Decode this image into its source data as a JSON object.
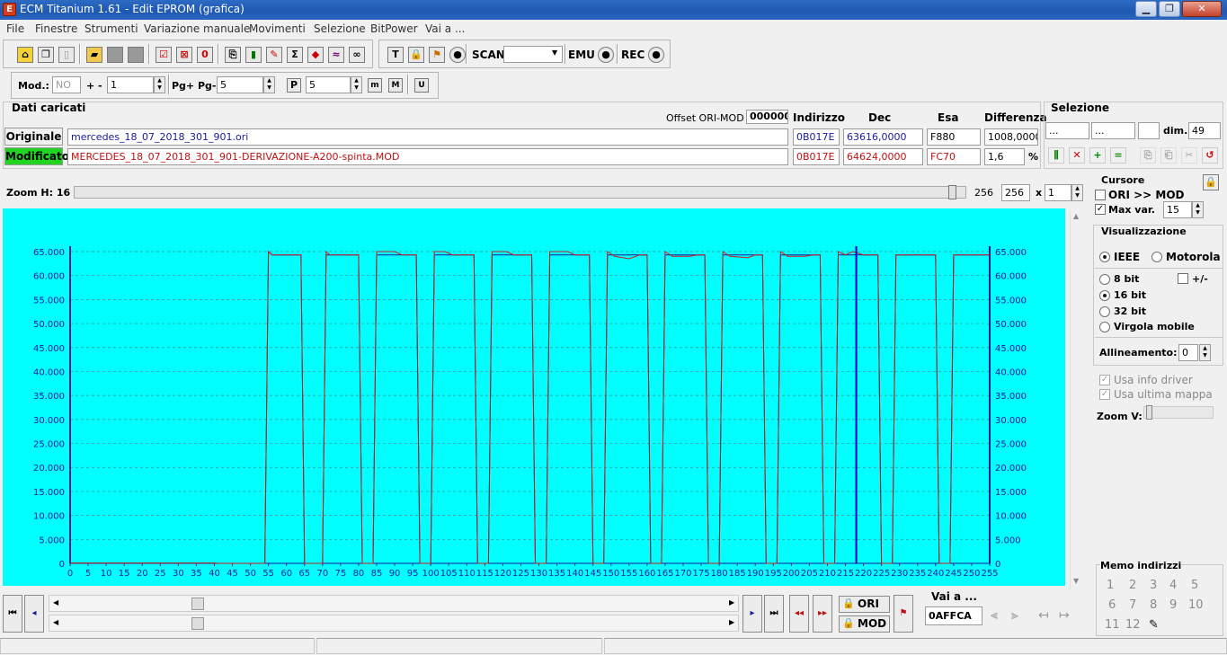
{
  "window": {
    "title": "ECM Titanium 1.61 - Edit EPROM (grafica)",
    "app_icon": "E"
  },
  "menu": [
    "File",
    "Finestre",
    "Strumenti",
    "Variazione manuale",
    "Movimenti",
    "Selezione",
    "BitPower",
    "Vai a ..."
  ],
  "toolbar1": {
    "scan_label": "SCAN",
    "emu_label": "EMU",
    "rec_label": "REC",
    "scan_value": ""
  },
  "toolbar2": {
    "mod_label": "Mod.:",
    "mod_value": "NO",
    "plus_minus_label": "+ -",
    "plus_minus_value": "1",
    "pg_label": "Pg+ Pg-",
    "pg_value": "5",
    "p_value": "5"
  },
  "dati": {
    "section_title": "Dati caricati",
    "offset_label": "Offset ORI-MOD",
    "offset_value": "000000",
    "col_indirizzo": "Indirizzo",
    "col_dec": "Dec",
    "col_esa": "Esa",
    "col_differenza": "Differenza",
    "originale_label": "Originale",
    "originale_file": "mercedes_18_07_2018_301_901.ori",
    "originale_addr": "0B017E",
    "originale_dec": "63616,0000",
    "originale_esa": "F880",
    "originale_diff": "1008,0000",
    "modificato_label": "Modificato",
    "modificato_file": "MERCEDES_18_07_2018_301_901-DERIVAZIONE-A200-spinta.MOD",
    "modificato_addr": "0B017E",
    "modificato_dec": "64624,0000",
    "modificato_esa": "FC70",
    "modificato_diff": "1,6",
    "percent": "%"
  },
  "selezione": {
    "title": "Selezione",
    "field1": "...",
    "field2": "...",
    "field3": "",
    "dim_label": "dim.",
    "dim_value": "49"
  },
  "zoom": {
    "label": "Zoom H: 16",
    "value_a": "256",
    "value_b": "256",
    "times": "x",
    "value_c": "1",
    "level": 0.99
  },
  "cursore": {
    "title": "Cursore",
    "ori_mod_label": "ORI >> MOD",
    "ori_mod_checked": false,
    "max_var_label": "Max var.",
    "max_var_checked": true,
    "max_var_value": "15"
  },
  "visualizzazione": {
    "title": "Visualizzazione",
    "ieee": "IEEE",
    "motorola": "Motorola",
    "endianness": "IEEE",
    "bit8": "8 bit",
    "bit16": "16 bit",
    "bit32": "32 bit",
    "float": "Virgola mobile",
    "selected_bits": "16 bit",
    "plusminus": "+/-",
    "allineamento_label": "Allineamento:",
    "allineamento_value": "0",
    "usa_info_driver": "Usa info driver",
    "usa_ultima_mappa": "Usa ultima mappa",
    "zoom_v_label": "Zoom V:"
  },
  "memo": {
    "title": "Memo indirizzi",
    "items": [
      "1",
      "2",
      "3",
      "4",
      "5",
      "6",
      "7",
      "8",
      "9",
      "10",
      "11",
      "12"
    ]
  },
  "bottom": {
    "ori_label": "ORI",
    "mod_label": "MOD",
    "vai_a_label": "Vai a ...",
    "vai_a_value": "0AFFCA",
    "scroll_pos": 0.2
  },
  "colors": {
    "chart_bg": "#00ffff",
    "ori_line": "#1a1aa0",
    "mod_line": "#d01a1a",
    "cursor": "#0000cc",
    "modificato_bg": "#21d421",
    "grid": "#4a8a8a"
  },
  "chart_data": {
    "type": "line",
    "xlim": [
      0,
      255
    ],
    "ylim": [
      0,
      65000
    ],
    "x_ticks": [
      0,
      5,
      10,
      15,
      20,
      25,
      30,
      35,
      40,
      45,
      50,
      55,
      60,
      65,
      70,
      75,
      80,
      85,
      90,
      95,
      100,
      105,
      110,
      115,
      120,
      125,
      130,
      135,
      140,
      145,
      150,
      155,
      160,
      165,
      170,
      175,
      180,
      185,
      190,
      195,
      200,
      205,
      210,
      215,
      220,
      225,
      230,
      235,
      240,
      245,
      250,
      255
    ],
    "y_ticks": [
      "0",
      "5.000",
      "10.000",
      "15.000",
      "20.000",
      "25.000",
      "30.000",
      "35.000",
      "40.000",
      "45.000",
      "50.000",
      "55.000",
      "60.000",
      "65.000"
    ],
    "y_tick_values": [
      0,
      5000,
      10000,
      15000,
      20000,
      25000,
      30000,
      35000,
      40000,
      45000,
      50000,
      55000,
      60000,
      65000
    ],
    "cursor_x": 218,
    "series": [
      {
        "color": "#1a1aa0",
        "points": [
          [
            0,
            30
          ],
          [
            40,
            30
          ],
          [
            41,
            0
          ],
          [
            54,
            0
          ],
          [
            55,
            65000
          ],
          [
            56,
            64300
          ],
          [
            64,
            64300
          ],
          [
            65,
            0
          ],
          [
            70,
            0
          ],
          [
            71,
            64300
          ],
          [
            80,
            64300
          ],
          [
            81,
            0
          ],
          [
            84,
            0
          ],
          [
            85,
            64300
          ],
          [
            96,
            64300
          ],
          [
            97,
            0
          ],
          [
            100,
            0
          ],
          [
            101,
            64300
          ],
          [
            112,
            64300
          ],
          [
            113,
            0
          ],
          [
            116,
            0
          ],
          [
            117,
            64300
          ],
          [
            128,
            64300
          ],
          [
            129,
            0
          ],
          [
            132,
            0
          ],
          [
            133,
            64300
          ],
          [
            144,
            64300
          ],
          [
            145,
            0
          ],
          [
            148,
            0
          ],
          [
            149,
            64300
          ],
          [
            160,
            64300
          ],
          [
            161,
            0
          ],
          [
            164,
            0
          ],
          [
            165,
            64300
          ],
          [
            176,
            64300
          ],
          [
            177,
            0
          ],
          [
            180,
            0
          ],
          [
            181,
            64300
          ],
          [
            192,
            64300
          ],
          [
            193,
            0
          ],
          [
            196,
            0
          ],
          [
            197,
            64300
          ],
          [
            208,
            64300
          ],
          [
            209,
            0
          ],
          [
            212,
            0
          ],
          [
            213,
            64300
          ],
          [
            224,
            64300
          ],
          [
            225,
            0
          ],
          [
            228,
            0
          ],
          [
            229,
            64300
          ],
          [
            240,
            64300
          ],
          [
            241,
            0
          ],
          [
            244,
            0
          ],
          [
            245,
            64300
          ],
          [
            255,
            64300
          ]
        ]
      },
      {
        "color": "#d01a1a",
        "points": [
          [
            0,
            30
          ],
          [
            40,
            30
          ],
          [
            41,
            0
          ],
          [
            54,
            0
          ],
          [
            55,
            65000
          ],
          [
            56,
            64300
          ],
          [
            64,
            64300
          ],
          [
            65,
            0
          ],
          [
            70,
            0
          ],
          [
            71,
            65000
          ],
          [
            72,
            64300
          ],
          [
            80,
            64300
          ],
          [
            81,
            0
          ],
          [
            84,
            0
          ],
          [
            85,
            65000
          ],
          [
            90,
            65000
          ],
          [
            92,
            64300
          ],
          [
            96,
            64300
          ],
          [
            97,
            0
          ],
          [
            100,
            0
          ],
          [
            101,
            65000
          ],
          [
            104,
            65000
          ],
          [
            106,
            64300
          ],
          [
            112,
            64300
          ],
          [
            113,
            0
          ],
          [
            116,
            0
          ],
          [
            117,
            65000
          ],
          [
            121,
            65000
          ],
          [
            123,
            64300
          ],
          [
            128,
            64300
          ],
          [
            129,
            0
          ],
          [
            132,
            0
          ],
          [
            133,
            65000
          ],
          [
            138,
            65000
          ],
          [
            140,
            64300
          ],
          [
            144,
            64300
          ],
          [
            145,
            0
          ],
          [
            148,
            0
          ],
          [
            149,
            65000
          ],
          [
            151,
            64000
          ],
          [
            155,
            63500
          ],
          [
            158,
            64300
          ],
          [
            160,
            64300
          ],
          [
            161,
            0
          ],
          [
            164,
            0
          ],
          [
            165,
            65000
          ],
          [
            167,
            64000
          ],
          [
            172,
            64000
          ],
          [
            174,
            64300
          ],
          [
            176,
            64300
          ],
          [
            177,
            0
          ],
          [
            180,
            0
          ],
          [
            181,
            65000
          ],
          [
            183,
            64000
          ],
          [
            188,
            63700
          ],
          [
            190,
            64300
          ],
          [
            192,
            64300
          ],
          [
            193,
            0
          ],
          [
            196,
            0
          ],
          [
            197,
            65000
          ],
          [
            199,
            64000
          ],
          [
            204,
            64000
          ],
          [
            206,
            64300
          ],
          [
            208,
            64300
          ],
          [
            209,
            0
          ],
          [
            212,
            0
          ],
          [
            213,
            65000
          ],
          [
            215,
            64300
          ],
          [
            217,
            65000
          ],
          [
            220,
            64300
          ],
          [
            224,
            64300
          ],
          [
            225,
            0
          ],
          [
            228,
            0
          ],
          [
            229,
            64300
          ],
          [
            240,
            64300
          ],
          [
            241,
            0
          ],
          [
            244,
            0
          ],
          [
            245,
            64300
          ],
          [
            255,
            64300
          ]
        ]
      }
    ]
  }
}
